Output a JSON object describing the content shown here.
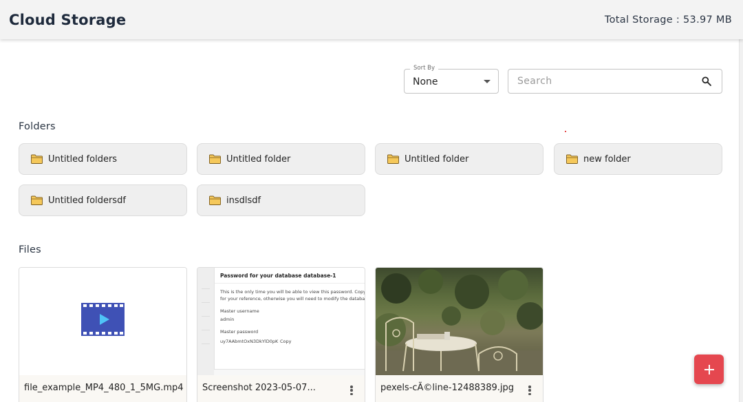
{
  "header": {
    "title": "Cloud Storage",
    "total_storage": "Total Storage : 53.97 MB"
  },
  "controls": {
    "sort_label": "Sort By",
    "sort_value": "None",
    "search_placeholder": "Search"
  },
  "sections": {
    "folders_title": "Folders",
    "files_title": "Files"
  },
  "folders": [
    {
      "label": "Untitled folders",
      "icon": "folder-icon"
    },
    {
      "label": "Untitled folder",
      "icon": "folder-icon"
    },
    {
      "label": "Untitled folder",
      "icon": "folder-icon"
    },
    {
      "label": "new folder",
      "icon": "folder-icon"
    },
    {
      "label": "Untitled foldersdf",
      "icon": "folder-icon"
    },
    {
      "label": "insdlsdf",
      "icon": "folder-icon"
    }
  ],
  "files": [
    {
      "name": "file_example_MP4_480_1_5MG.mp4",
      "thumbnail": "video-icon",
      "has_menu": false
    },
    {
      "name": "Screenshot 2023-05-07...",
      "thumbnail": "screenshot",
      "has_menu": true
    },
    {
      "name": "pexels-cÃ©line-12488389.jpg",
      "thumbnail": "photo",
      "has_menu": true
    }
  ],
  "screenshot_preview": {
    "title": "Password for your database database-1",
    "line1": "This is the only time you will be able to view this password. Copy and save",
    "line2": "for your reference, otherwise you will need to modify the database to cha",
    "username_label": "Master username",
    "username_value": "admin",
    "password_label": "Master password",
    "password_value": "uy7AAbmtOxN3DkYlD0pK",
    "copy_label": "Copy"
  },
  "fab_icon": "plus-icon",
  "colors": {
    "header_bg": "#f3f3f3",
    "folder_bg": "#efefef",
    "folder_icon": "#f5c85a",
    "video_icon": "#3f51b5",
    "fab": "#e5474f"
  }
}
